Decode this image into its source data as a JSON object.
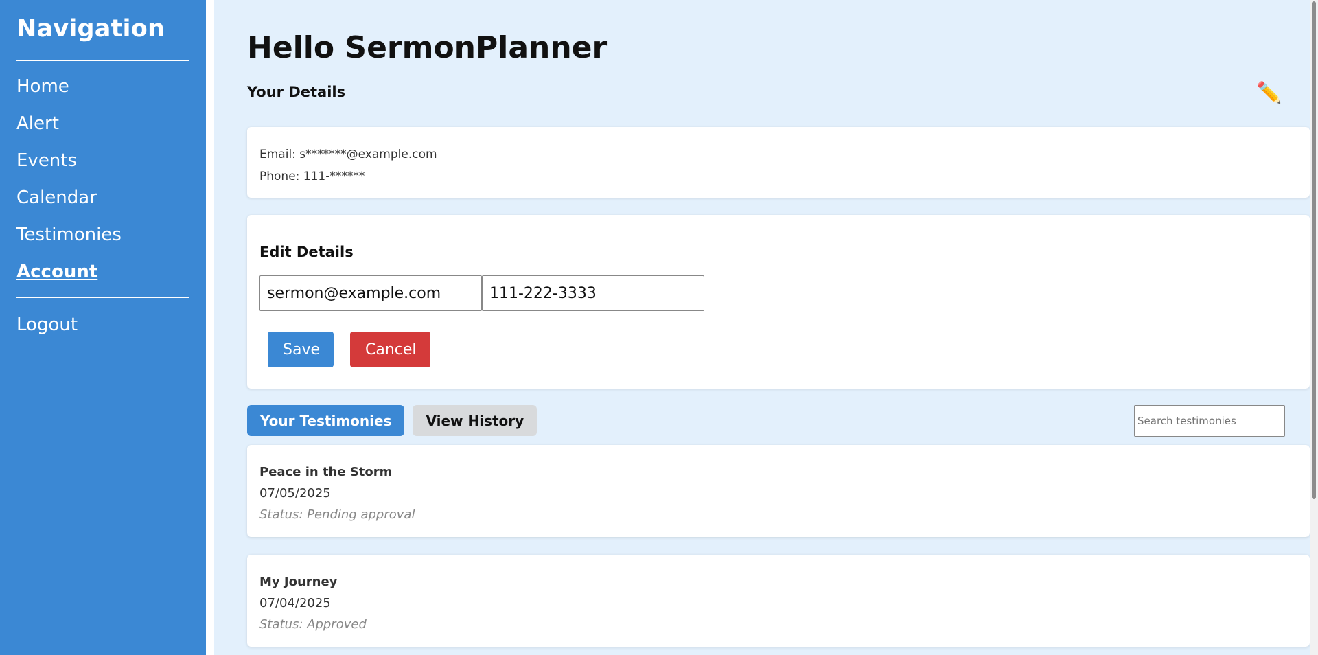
{
  "sidebar": {
    "title": "Navigation",
    "items": [
      {
        "label": "Home"
      },
      {
        "label": "Alert"
      },
      {
        "label": "Events"
      },
      {
        "label": "Calendar"
      },
      {
        "label": "Testimonies"
      },
      {
        "label": "Account"
      }
    ],
    "logout_label": "Logout",
    "active_item": "Account"
  },
  "main": {
    "greeting": "Hello SermonPlanner",
    "details_title": "Your Details",
    "edit_icon": "pencil-icon",
    "email_line": "Email: s*******@example.com",
    "phone_line": "Phone: 111-******",
    "edit": {
      "title": "Edit Details",
      "email_value": "sermon@example.com",
      "phone_value": "111-222-3333",
      "save_label": "Save",
      "cancel_label": "Cancel"
    },
    "tabs": {
      "testimonies_label": "Your Testimonies",
      "history_label": "View History"
    },
    "search": {
      "placeholder": "Search testimonies"
    },
    "testimonies": [
      {
        "title": "Peace in the Storm",
        "date": "07/05/2025",
        "status": "Status: Pending approval"
      },
      {
        "title": "My Journey",
        "date": "07/04/2025",
        "status": "Status: Approved"
      }
    ]
  },
  "colors": {
    "sidebar": "#3b88d4",
    "background": "#e3f0fc",
    "save": "#3b88d4",
    "cancel": "#d43a3a"
  }
}
